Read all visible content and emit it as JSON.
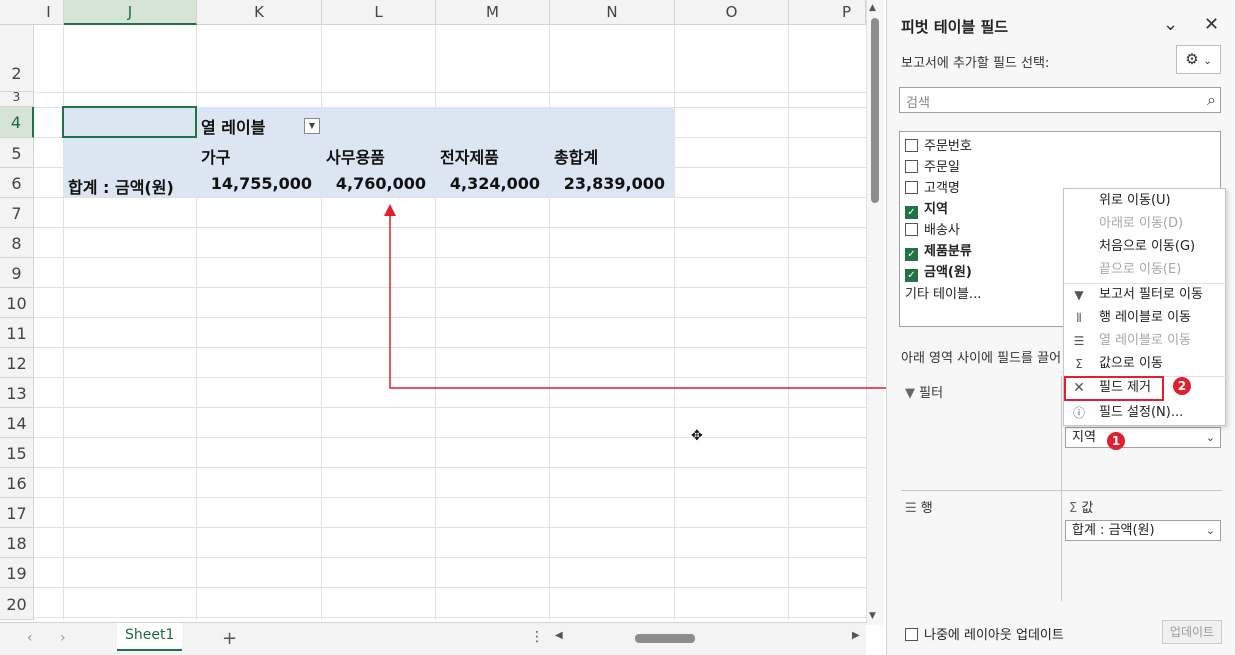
{
  "columns": [
    {
      "label": "I"
    },
    {
      "label": "J",
      "selected": true
    },
    {
      "label": "K"
    },
    {
      "label": "L"
    },
    {
      "label": "M"
    },
    {
      "label": "N"
    },
    {
      "label": "O"
    },
    {
      "label": "P"
    }
  ],
  "rows": [
    "2",
    "3",
    "4",
    "5",
    "6",
    "7",
    "8",
    "9",
    "10",
    "11",
    "12",
    "13",
    "14",
    "15",
    "16",
    "17",
    "18",
    "19",
    "20"
  ],
  "pivot": {
    "col_labels_header": "열 레이블",
    "headers": [
      "가구",
      "사무용품",
      "전자제품",
      "총합계"
    ],
    "row_label": "합계 : 금액(원)",
    "values": [
      "14,755,000",
      "4,760,000",
      "4,324,000",
      "23,839,000"
    ]
  },
  "sheet_tabs": {
    "active": "Sheet1",
    "add": "+"
  },
  "panel": {
    "title": "피벗 테이블 필드",
    "subtitle": "보고서에 추가할 필드 선택:",
    "search_placeholder": "검색",
    "fields": [
      {
        "label": "주문번호",
        "checked": false
      },
      {
        "label": "주문일",
        "checked": false
      },
      {
        "label": "고객명",
        "checked": false
      },
      {
        "label": "지역",
        "checked": true
      },
      {
        "label": "배송사",
        "checked": false
      },
      {
        "label": "제품분류",
        "checked": true
      },
      {
        "label": "금액(원)",
        "checked": true
      }
    ],
    "more_tables": "기타 테이블...",
    "drag_hint": "아래 영역 사이에 필드를 끌어",
    "areas": {
      "filter": "필터",
      "rows": "행",
      "values": "값",
      "columns_value": "지역",
      "values_value": "합계 : 금액(원)"
    },
    "defer_label": "나중에 레이아웃 업데이트",
    "update_button": "업데이트"
  },
  "context_menu": {
    "items": [
      {
        "label": "위로 이동(U)",
        "disabled": false
      },
      {
        "label": "아래로 이동(D)",
        "disabled": true
      },
      {
        "label": "처음으로 이동(G)",
        "disabled": false
      },
      {
        "label": "끝으로 이동(E)",
        "disabled": true
      },
      {
        "label": "보고서 필터로 이동",
        "disabled": false
      },
      {
        "label": "행 레이블로 이동",
        "disabled": false
      },
      {
        "label": "열 레이블로 이동",
        "disabled": true
      },
      {
        "label": "값으로 이동",
        "disabled": false
      },
      {
        "label": "필드 제거",
        "disabled": false
      },
      {
        "label": "필드 설정(N)...",
        "disabled": false
      }
    ]
  },
  "badges": {
    "first": "1",
    "second": "2"
  },
  "colors": {
    "accent": "#217346",
    "annotation": "#e0202f",
    "pivot_bg": "#dce6f3"
  }
}
